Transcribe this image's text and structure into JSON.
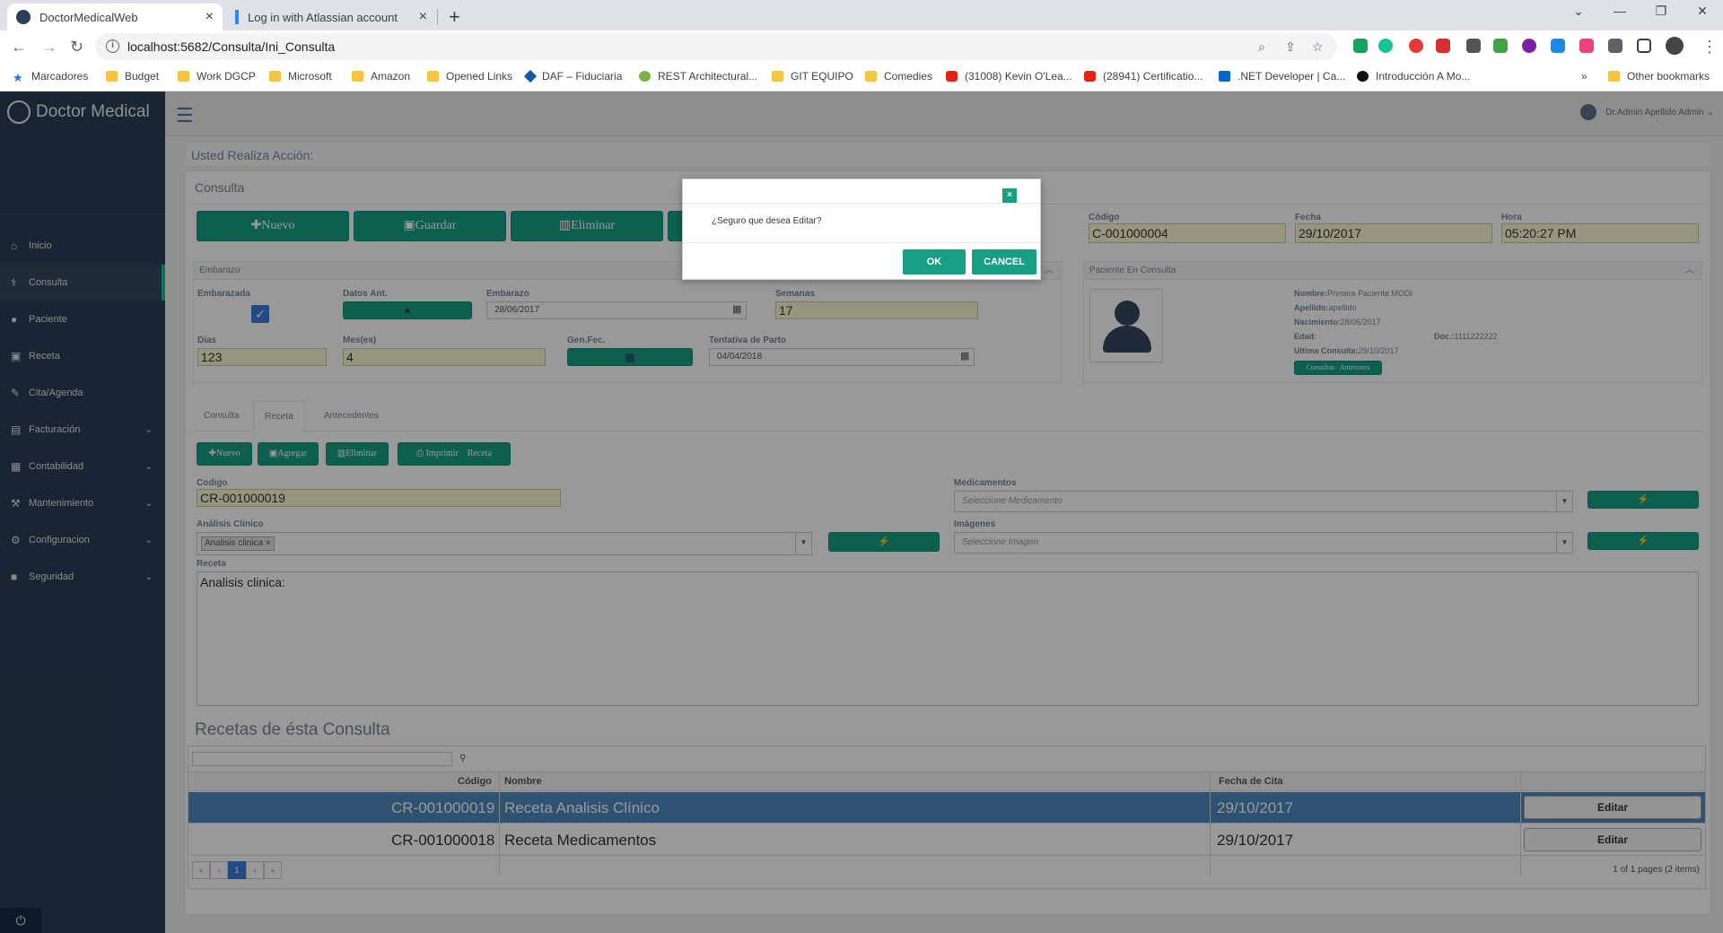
{
  "browser": {
    "tabs": [
      {
        "title": "DoctorMedicalWeb",
        "active": true
      },
      {
        "title": "Log in with Atlassian account",
        "active": false
      }
    ],
    "url": "localhost:5682/Consulta/Ini_Consulta",
    "bookmarks": [
      "Marcadores",
      "Budget",
      "Work DGCP",
      "Microsoft",
      "Amazon",
      "Opened Links",
      "DAF – Fiduciaria",
      "REST Architectural...",
      "GIT EQUIPO",
      "Comedies",
      "(31008) Kevin O'Lea...",
      "(28941) Certificatio...",
      ".NET Developer | Ca...",
      "Introducción A Mo..."
    ],
    "bookmarks_more": "»",
    "other_bookmarks": "Other bookmarks"
  },
  "app": {
    "brand": "Doctor Medical",
    "user": "Dr.Admin Apellido Admin",
    "menu": [
      {
        "label": "Inicio",
        "icon": "home-icon",
        "has_submenu": false
      },
      {
        "label": "Consulta",
        "icon": "stethoscope-icon",
        "has_submenu": false,
        "current": true
      },
      {
        "label": "Paciente",
        "icon": "user-icon",
        "has_submenu": false
      },
      {
        "label": "Receta",
        "icon": "medkit-icon",
        "has_submenu": false
      },
      {
        "label": "Cita/Agenda",
        "icon": "edit-icon",
        "has_submenu": false
      },
      {
        "label": "Facturación",
        "icon": "file-icon",
        "has_submenu": true
      },
      {
        "label": "Contabilidad",
        "icon": "table-icon",
        "has_submenu": true
      },
      {
        "label": "Mantenimiento",
        "icon": "wrench-icon",
        "has_submenu": true
      },
      {
        "label": "Configuracion",
        "icon": "gear-icon",
        "has_submenu": true
      },
      {
        "label": "Seguridad",
        "icon": "lock-icon",
        "has_submenu": true
      }
    ]
  },
  "consulta": {
    "action_text": "Usted Realiza Acción:",
    "title": "Consulta",
    "buttons": {
      "nuevo": "Nuevo",
      "guardar": "Guardar",
      "eliminar": "Eliminar"
    },
    "codigo_label": "Código",
    "codigo": "C-001000004",
    "fecha_label": "Fecha",
    "fecha": "29/10/2017",
    "hora_label": "Hora",
    "hora": "05:20:27 PM"
  },
  "embarazo": {
    "header": "Embarazo",
    "embarazada_label": "Embarazada",
    "embarazada_checked": true,
    "datos_ant_label": "Datos Ant.",
    "embarazo_label": "Embarazo",
    "embarazo_date": "28/06/2017",
    "semanas_label": "Semanas",
    "semanas": "17",
    "dias_label": "Dias",
    "dias": "123",
    "meses_label": "Mes(es)",
    "meses": "4",
    "genfec_label": "Gen.Fec.",
    "tentativa_label": "Tentativa de Parto",
    "tentativa_date": "04/04/2018"
  },
  "paciente": {
    "header": "Paciente En Consulta",
    "nombre_label": "Nombre:",
    "nombre": "Primera Paciente MODI",
    "apellido_label": "Apellido:",
    "apellido": "apellido",
    "nacimiento_label": "Nacimiento:",
    "nacimiento": "28/06/2017",
    "edad_label": "Edad:",
    "doc_label": "Doc.:",
    "doc": "1111222222",
    "ultima_label": "Ultima Consulta:",
    "ultima": "29/10/2017",
    "consultas_btn": "Consultas   Anteriores"
  },
  "tabs": [
    {
      "label": "Consulta",
      "active": false
    },
    {
      "label": "Receta",
      "active": true
    },
    {
      "label": "Antecedentes",
      "active": false
    }
  ],
  "receta": {
    "buttons": {
      "nuevo": "Nuevo",
      "agregar": "Agregar",
      "eliminar": "Eliminar",
      "imprimir": "Imprimir    Receta"
    },
    "codigo_label": "Codigo",
    "codigo": "CR-001000019",
    "analisis_label": "Análisis Clínico",
    "analisis_tag": "Analisis clinica",
    "medicamentos_label": "Medicamentos",
    "medicamentos_placeholder": "Seleccione Medicamento",
    "imagenes_label": "Imágenes",
    "imagenes_placeholder": "Seleccione Imagen",
    "receta_label": "Receta",
    "receta_text": "Analisis clinica:"
  },
  "grid": {
    "title": "Recetas de ésta Consulta",
    "columns": [
      "Código",
      "Nombre",
      "Fecha de Cita"
    ],
    "rows": [
      {
        "codigo": "CR-001000019",
        "nombre": "Receta Analisis Clínico",
        "fecha": "29/10/2017",
        "action": "Editar",
        "selected": true
      },
      {
        "codigo": "CR-001000018",
        "nombre": "Receta Medicamentos",
        "fecha": "29/10/2017",
        "action": "Editar",
        "selected": false
      }
    ],
    "pager": {
      "first": "«",
      "prev": "‹",
      "current": "1",
      "next": "›",
      "last": "»"
    },
    "pager_info": "1 of 1 pages (2 items)"
  },
  "modal": {
    "close": "×",
    "message": "¿Seguro que desea Editar?",
    "ok": "OK",
    "cancel": "CANCEL"
  },
  "colors": {
    "accent": "#169f85",
    "sidebar": "#2a3f54",
    "selected_row": "#4e8bbf"
  }
}
